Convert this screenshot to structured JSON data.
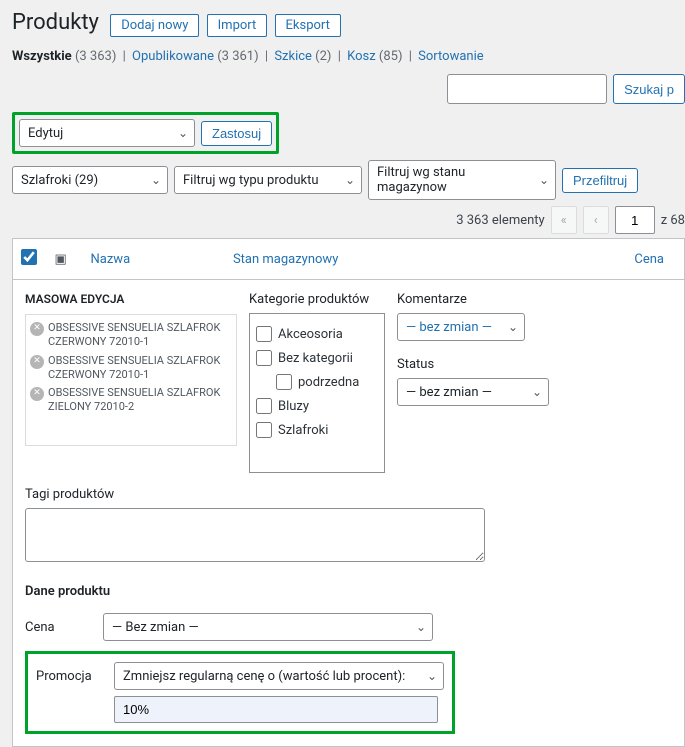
{
  "header": {
    "title": "Produkty",
    "add_new": "Dodaj nowy",
    "import": "Import",
    "export": "Eksport"
  },
  "views": {
    "all_label": "Wszystkie",
    "all_count": "(3 363)",
    "published_label": "Opublikowane",
    "published_count": "(3 361)",
    "drafts_label": "Szkice",
    "drafts_count": "(2)",
    "trash_label": "Kosz",
    "trash_count": "(85)",
    "sorting_label": "Sortowanie"
  },
  "search": {
    "button": "Szukaj p"
  },
  "bulk": {
    "action": "Edytuj",
    "apply": "Zastosuj"
  },
  "filters": {
    "category": "Szlafroki  (29)",
    "type": "Filtruj wg typu produktu",
    "stock": "Filtruj wg stanu magazynow",
    "filter_btn": "Przefiltruj"
  },
  "pagination": {
    "items_text": "3 363 elementy",
    "prev2": "«",
    "prev1": "‹",
    "current": "1",
    "of_text": "z 68"
  },
  "columns": {
    "name": "Nazwa",
    "stock": "Stan magazynowy",
    "price": "Cena"
  },
  "bulk_edit": {
    "title": "MASOWA EDYCJA",
    "items": [
      "OBSESSIVE SENSUELIA SZLAFROK CZERWONY 72010-1",
      "OBSESSIVE SENSUELIA SZLAFROK CZERWONY 72010-1",
      "OBSESSIVE SENSUELIA SZLAFROK ZIELONY 72010-2"
    ],
    "cat_label": "Kategorie produktów",
    "categories": [
      "Akceosoria",
      "Bez kategorii",
      "podrzedna",
      "Bluzy",
      "Szlafroki"
    ],
    "comments_label": "Komentarze",
    "comments_value": "— bez zmian —",
    "status_label": "Status",
    "status_value": "— bez zmian —",
    "tags_label": "Tagi produktów",
    "product_data_label": "Dane produktu",
    "price_label": "Cena",
    "price_value": "— Bez zmian —",
    "promo_label": "Promocja",
    "promo_select": "Zmniejsz regularną cenę o (wartość lub procent):",
    "promo_input": "10%"
  }
}
